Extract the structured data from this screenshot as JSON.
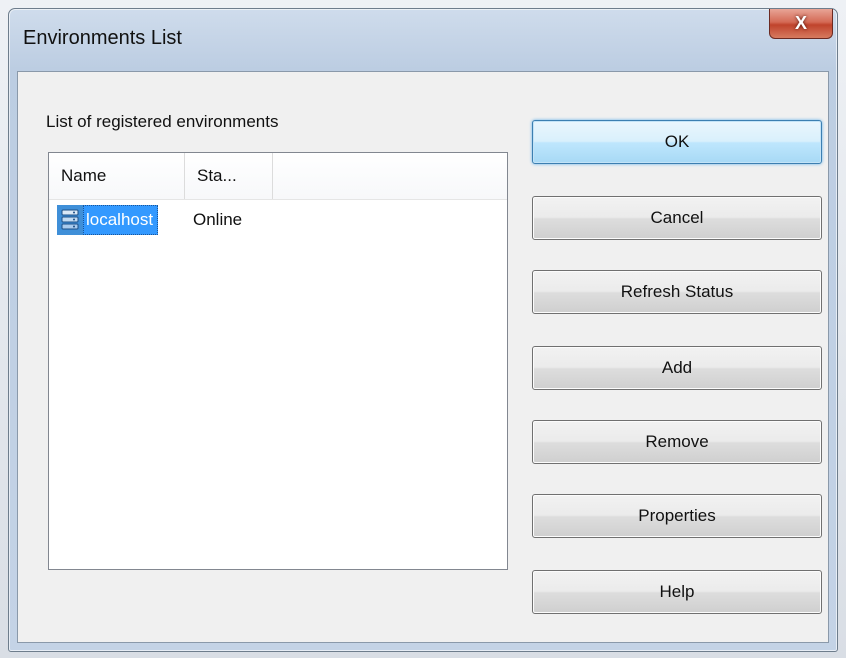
{
  "window": {
    "title": "Environments List",
    "close_label": "X"
  },
  "list": {
    "caption": "List of registered environments",
    "columns": [
      "Name",
      "Sta..."
    ],
    "rows": [
      {
        "name": "localhost",
        "status": "Online",
        "icon": "server-stack-icon",
        "selected": true
      }
    ]
  },
  "buttons": {
    "ok": "OK",
    "cancel": "Cancel",
    "refresh": "Refresh Status",
    "add": "Add",
    "remove": "Remove",
    "properties": "Properties",
    "help": "Help"
  },
  "colors": {
    "selection": "#3399ff",
    "default_button_border": "#3c7fb1",
    "close_button": "#c0432c"
  }
}
